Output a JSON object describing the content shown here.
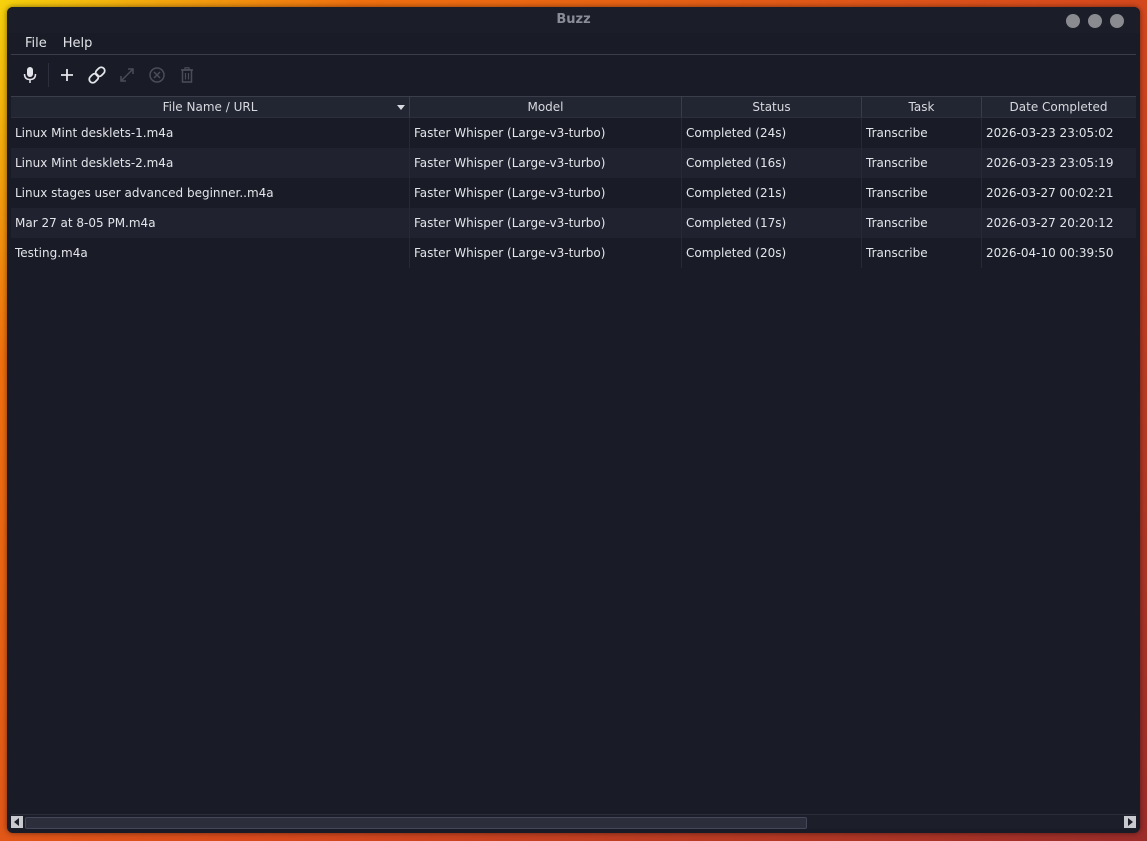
{
  "window": {
    "title": "Buzz"
  },
  "menu": [
    "File",
    "Help"
  ],
  "toolbar": {
    "buttons": [
      {
        "name": "record-button",
        "icon": "microphone-icon",
        "enabled": true
      },
      {
        "name": "add-file-button",
        "icon": "plus-icon",
        "enabled": true
      },
      {
        "name": "import-url-button",
        "icon": "link-icon",
        "enabled": true
      },
      {
        "name": "open-transcript-button",
        "icon": "expand-icon",
        "enabled": false
      },
      {
        "name": "cancel-button",
        "icon": "cancel-circle-icon",
        "enabled": false
      },
      {
        "name": "delete-button",
        "icon": "trash-icon",
        "enabled": false
      }
    ]
  },
  "table": {
    "headers": [
      "File Name / URL",
      "Model",
      "Status",
      "Task",
      "Date Completed"
    ],
    "rows": [
      [
        "Linux Mint desklets-1.m4a",
        "Faster Whisper (Large-v3-turbo)",
        "Completed (24s)",
        "Transcribe",
        "2026-03-23 23:05:02"
      ],
      [
        "Linux Mint desklets-2.m4a",
        "Faster Whisper (Large-v3-turbo)",
        "Completed (16s)",
        "Transcribe",
        "2026-03-23 23:05:19"
      ],
      [
        "Linux stages user advanced beginner..m4a",
        "Faster Whisper (Large-v3-turbo)",
        "Completed (21s)",
        "Transcribe",
        "2026-03-27 00:02:21"
      ],
      [
        "Mar 27 at 8-05 PM.m4a",
        "Faster Whisper (Large-v3-turbo)",
        "Completed (17s)",
        "Transcribe",
        "2026-03-27 20:20:12"
      ],
      [
        "Testing.m4a",
        "Faster Whisper (Large-v3-turbo)",
        "Completed (20s)",
        "Transcribe",
        "2026-04-10 00:39:50"
      ]
    ]
  },
  "colors": {
    "window_bg": "#191b26",
    "row_alt_bg": "#20232f",
    "text": "#e4e5ea"
  }
}
